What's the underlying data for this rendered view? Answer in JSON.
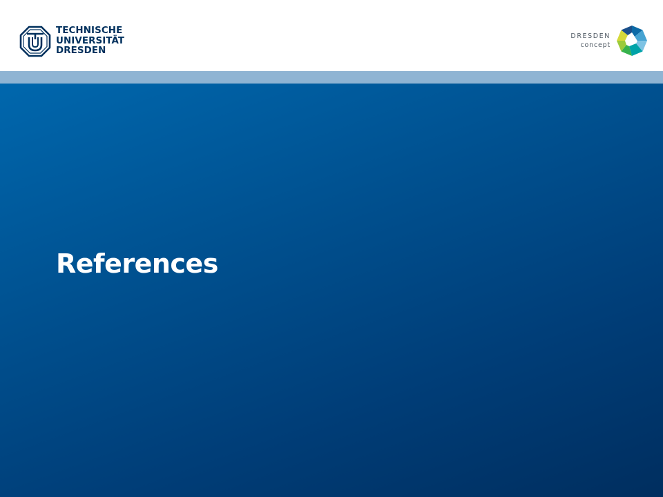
{
  "header": {
    "university_logo": {
      "icon": "tu-dresden-emblem-icon",
      "lines": [
        "TECHNISCHE",
        "UNIVERSITÄT",
        "DRESDEN"
      ]
    },
    "partner_logo": {
      "icon": "dresden-concept-octagon-icon",
      "line1": "DRESDEN",
      "line2": "concept"
    }
  },
  "slide": {
    "title": "References"
  },
  "colors": {
    "brand_dark_blue": "#00305d",
    "accent_bar": "#8fb4d3",
    "content_gradient_start": "#0067ad",
    "content_gradient_end": "#002e5f",
    "title_text": "#ffffff"
  }
}
